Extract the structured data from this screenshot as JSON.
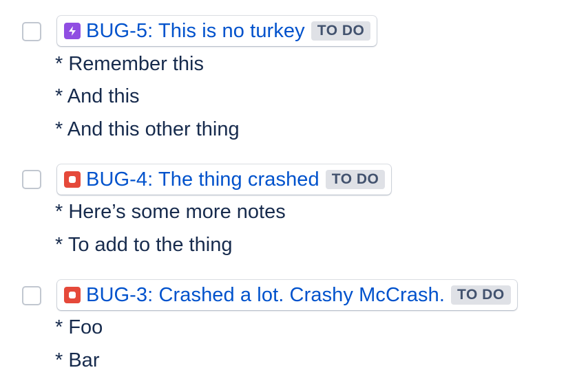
{
  "tasks": [
    {
      "issue_type_icon": "lightning-icon",
      "issue_type_color": "#904ee2",
      "title": "BUG-5: This is no turkey",
      "status": "TO DO",
      "notes": [
        "* Remember this",
        "* And this",
        "* And this other thing"
      ]
    },
    {
      "issue_type_icon": "bug-icon",
      "issue_type_color": "#e5493a",
      "title": "BUG-4: The thing crashed",
      "status": "TO DO",
      "notes": [
        "* Here’s some more notes",
        "* To add to the thing"
      ]
    },
    {
      "issue_type_icon": "bug-icon",
      "issue_type_color": "#e5493a",
      "title": "BUG-3: Crashed a lot. Crashy McCrash.",
      "status": "TO DO",
      "notes": [
        "* Foo",
        "* Bar"
      ]
    }
  ],
  "colors": {
    "link": "#0052cc",
    "text": "#172b4d",
    "lozenge_bg": "#dfe1e6",
    "lozenge_text": "#42526e",
    "checkbox_border": "#c1c7d0"
  }
}
